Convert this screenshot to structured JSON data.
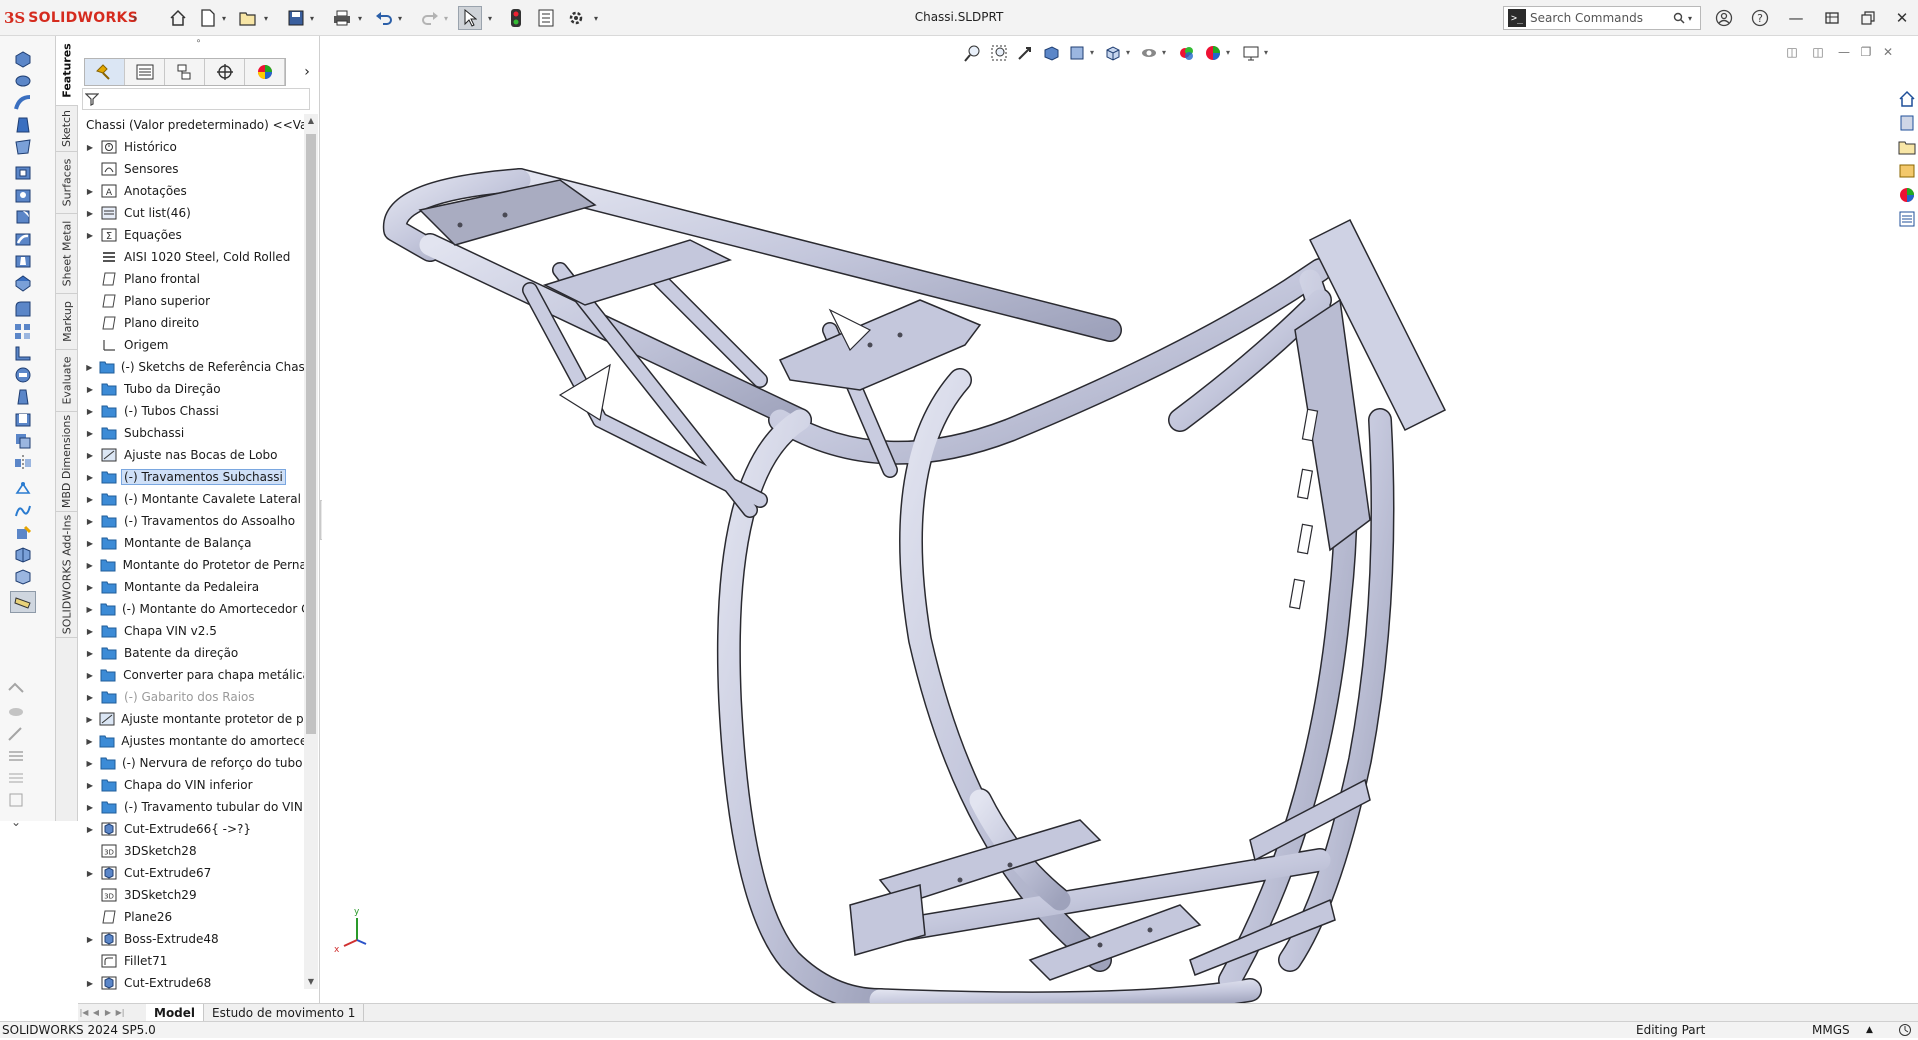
{
  "app": {
    "brand_prefix": "3S",
    "brand_name": "SOLIDWORKS",
    "document_title": "Chassi.SLDPRT",
    "search_placeholder": "Search Commands",
    "brand_color": "#d52b1e"
  },
  "toolbar": {
    "icons": [
      "home-icon",
      "new-document-icon",
      "open-icon",
      "save-icon",
      "print-icon",
      "undo-icon",
      "redo-icon",
      "select-icon",
      "rebuild-icon",
      "file-properties-icon",
      "options-icon"
    ]
  },
  "window_controls": [
    "user-icon",
    "help-icon",
    "minimize-icon",
    "restore-panel-icon",
    "restore-icon",
    "close-icon"
  ],
  "command_tabs": [
    "Features",
    "Sketch",
    "Surfaces",
    "Sheet Metal",
    "Markup",
    "Evaluate",
    "MBD Dimensions",
    "SOLIDWORKS Add-Ins"
  ],
  "active_command_tab": "Features",
  "feature_manager": {
    "root_label": "Chassi (Valor predeterminado) <<Val",
    "items": [
      {
        "label": "Histórico",
        "icon": "history-icon",
        "expandable": true
      },
      {
        "label": "Sensores",
        "icon": "sensor-icon",
        "expandable": false
      },
      {
        "label": "Anotações",
        "icon": "annotations-icon",
        "expandable": true
      },
      {
        "label": "Cut list(46)",
        "icon": "cut-list-icon",
        "expandable": true
      },
      {
        "label": "Equações",
        "icon": "equations-icon",
        "expandable": true
      },
      {
        "label": "AISI 1020 Steel, Cold Rolled",
        "icon": "material-icon",
        "expandable": false
      },
      {
        "label": "Plano frontal",
        "icon": "plane-icon",
        "expandable": false
      },
      {
        "label": "Plano superior",
        "icon": "plane-icon",
        "expandable": false
      },
      {
        "label": "Plano direito",
        "icon": "plane-icon",
        "expandable": false
      },
      {
        "label": "Origem",
        "icon": "origin-icon",
        "expandable": false
      },
      {
        "label": "(-) Sketchs de Referência Chassi P",
        "icon": "folder-icon",
        "expandable": true
      },
      {
        "label": "Tubo da Direção",
        "icon": "folder-icon",
        "expandable": true
      },
      {
        "label": "(-) Tubos Chassi",
        "icon": "folder-icon",
        "expandable": true
      },
      {
        "label": "Subchassi",
        "icon": "folder-icon",
        "expandable": true
      },
      {
        "label": "Ajuste nas Bocas de Lobo",
        "icon": "feature-icon",
        "expandable": true
      },
      {
        "label": "(-) Travamentos Subchassi",
        "icon": "folder-icon",
        "expandable": true,
        "selected": true
      },
      {
        "label": "(-) Montante Cavalete Lateral",
        "icon": "folder-icon",
        "expandable": true
      },
      {
        "label": "(-) Travamentos do Assoalho",
        "icon": "folder-icon",
        "expandable": true
      },
      {
        "label": "Montante de Balança",
        "icon": "folder-icon",
        "expandable": true
      },
      {
        "label": "Montante do Protetor de Pernas",
        "icon": "folder-icon",
        "expandable": true
      },
      {
        "label": "Montante da Pedaleira",
        "icon": "folder-icon",
        "expandable": true
      },
      {
        "label": "(-) Montante do Amortecedor Ch",
        "icon": "folder-icon",
        "expandable": true
      },
      {
        "label": "Chapa VIN v2.5",
        "icon": "folder-icon",
        "expandable": true
      },
      {
        "label": "Batente da direção",
        "icon": "folder-icon",
        "expandable": true
      },
      {
        "label": "Converter para chapa metálica",
        "icon": "folder-icon",
        "expandable": true
      },
      {
        "label": "(-) Gabarito dos Raios",
        "icon": "folder-icon",
        "expandable": true,
        "dim": true
      },
      {
        "label": "Ajuste montante protetor de pern",
        "icon": "feature-icon",
        "expandable": true
      },
      {
        "label": "Ajustes montante do amortecedo",
        "icon": "folder-icon",
        "expandable": true
      },
      {
        "label": "(-) Nervura de reforço do tubo in",
        "icon": "folder-icon",
        "expandable": true
      },
      {
        "label": "Chapa do VIN inferior",
        "icon": "folder-icon",
        "expandable": true
      },
      {
        "label": "(-) Travamento tubular do VIN",
        "icon": "folder-icon",
        "expandable": true
      },
      {
        "label": "Cut-Extrude66{ ->?}",
        "icon": "extrude-icon",
        "expandable": true
      },
      {
        "label": "3DSketch28",
        "icon": "sketch3d-icon",
        "expandable": false
      },
      {
        "label": "Cut-Extrude67",
        "icon": "extrude-icon",
        "expandable": true
      },
      {
        "label": "3DSketch29",
        "icon": "sketch3d-icon",
        "expandable": false
      },
      {
        "label": "Plane26",
        "icon": "plane-icon",
        "expandable": false
      },
      {
        "label": "Boss-Extrude48",
        "icon": "extrude-icon",
        "expandable": true
      },
      {
        "label": "Fillet71",
        "icon": "fillet-icon",
        "expandable": false
      },
      {
        "label": "Cut-Extrude68",
        "icon": "extrude-icon",
        "expandable": true
      }
    ]
  },
  "bottom_tabs": [
    "Model",
    "Estudo de movimento 1"
  ],
  "active_bottom_tab": "Model",
  "status": {
    "version": "SOLIDWORKS 2024 SP5.0",
    "mode": "Editing Part",
    "units": "MMGS"
  },
  "colors": {
    "model_fill": "#c9cce0",
    "model_edge": "#2a2a30",
    "selection": "#cfe0f7"
  },
  "triad_labels": {
    "y": "y",
    "x": "x"
  }
}
